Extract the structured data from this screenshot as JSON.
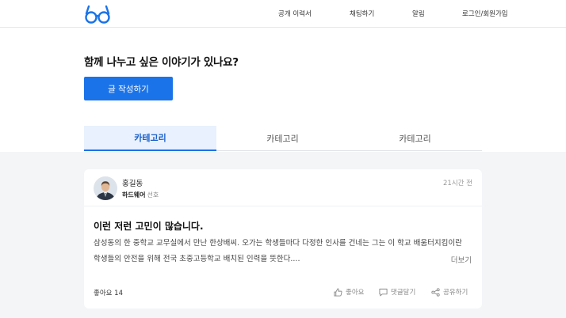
{
  "header": {
    "nav": [
      {
        "label": "공개 이력서"
      },
      {
        "label": "채팅하기"
      },
      {
        "label": "알림"
      },
      {
        "label": "로그인/회원가입"
      }
    ]
  },
  "compose": {
    "prompt": "함께 나누고 싶은 이야기가 있나요?",
    "button": "글 작성하기"
  },
  "tabs": [
    {
      "label": "카테고리",
      "active": true
    },
    {
      "label": "카테고리",
      "active": false
    },
    {
      "label": "카테고리",
      "active": false
    }
  ],
  "post": {
    "author": "홍길동",
    "role": "하드웨어",
    "role_suffix": "선호",
    "time": "21시간 전",
    "title": "이런 저런 고민이 많습니다.",
    "body": "삼성동의 한 중학교 교무실에서 만난 한상배씨. 오가는 학생들마다 다정한 인사를 건네는 그는 이 학교 배움터지킴이란 학생들의 안전을 위해 전국 초중고등학교 배치된 인력을 뜻한다....",
    "more": "더보기",
    "likes": "좋아요 14",
    "actions": {
      "like": "좋아요",
      "comment": "댓글달기",
      "share": "공유하기"
    }
  },
  "colors": {
    "accent": "#1a73e8",
    "background": "#f3f5f7"
  }
}
